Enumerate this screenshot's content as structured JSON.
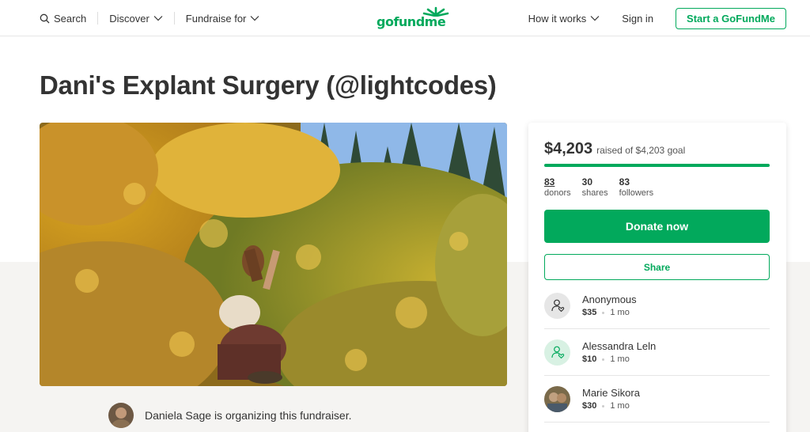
{
  "header": {
    "search_label": "Search",
    "discover_label": "Discover",
    "fundraise_label": "Fundraise for",
    "logo_text": "gofundme",
    "how_it_works_label": "How it works",
    "sign_in_label": "Sign in",
    "start_button_label": "Start a GoFundMe"
  },
  "campaign": {
    "title": "Dani's Explant Surgery (@lightcodes)",
    "organizer_text": "Daniela Sage is organizing this fundraiser."
  },
  "sidebar": {
    "raised_amount": "$4,203",
    "raised_goal_text": "raised of $4,203 goal",
    "progress_fraction": 1.0,
    "stats": [
      {
        "num": "83",
        "label": "donors"
      },
      {
        "num": "30",
        "label": "shares"
      },
      {
        "num": "83",
        "label": "followers"
      }
    ],
    "donate_label": "Donate now",
    "share_label": "Share",
    "donations": [
      {
        "name": "Anonymous",
        "amount": "$35",
        "time": "1 mo"
      },
      {
        "name": "Alessandra Leln",
        "amount": "$10",
        "time": "1 mo"
      },
      {
        "name": "Marie Sikora",
        "amount": "$30",
        "time": "1 mo"
      }
    ]
  },
  "colors": {
    "brand_green": "#02a95c"
  },
  "icons": {
    "search": "search-icon",
    "chevron": "chevron-down-icon",
    "donor": "donor-heart-icon"
  }
}
